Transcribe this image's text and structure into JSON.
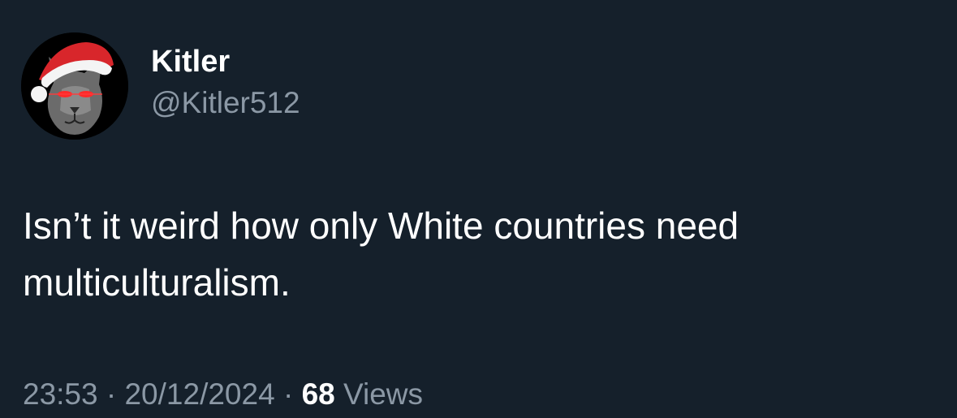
{
  "tweet": {
    "author": {
      "display_name": "Kitler",
      "handle": "@Kitler512",
      "avatar_icon": "cat-santa-hat-avatar"
    },
    "text_lines": [
      "Isn’t it weird how only White countries need",
      "multiculturalism."
    ],
    "time": "23:53",
    "separator": " · ",
    "date": "20/12/2024",
    "views_count": "68",
    "views_label": " Views"
  },
  "colors": {
    "background": "#15202b",
    "primary_text": "#ffffff",
    "secondary_text": "#8b98a5"
  }
}
